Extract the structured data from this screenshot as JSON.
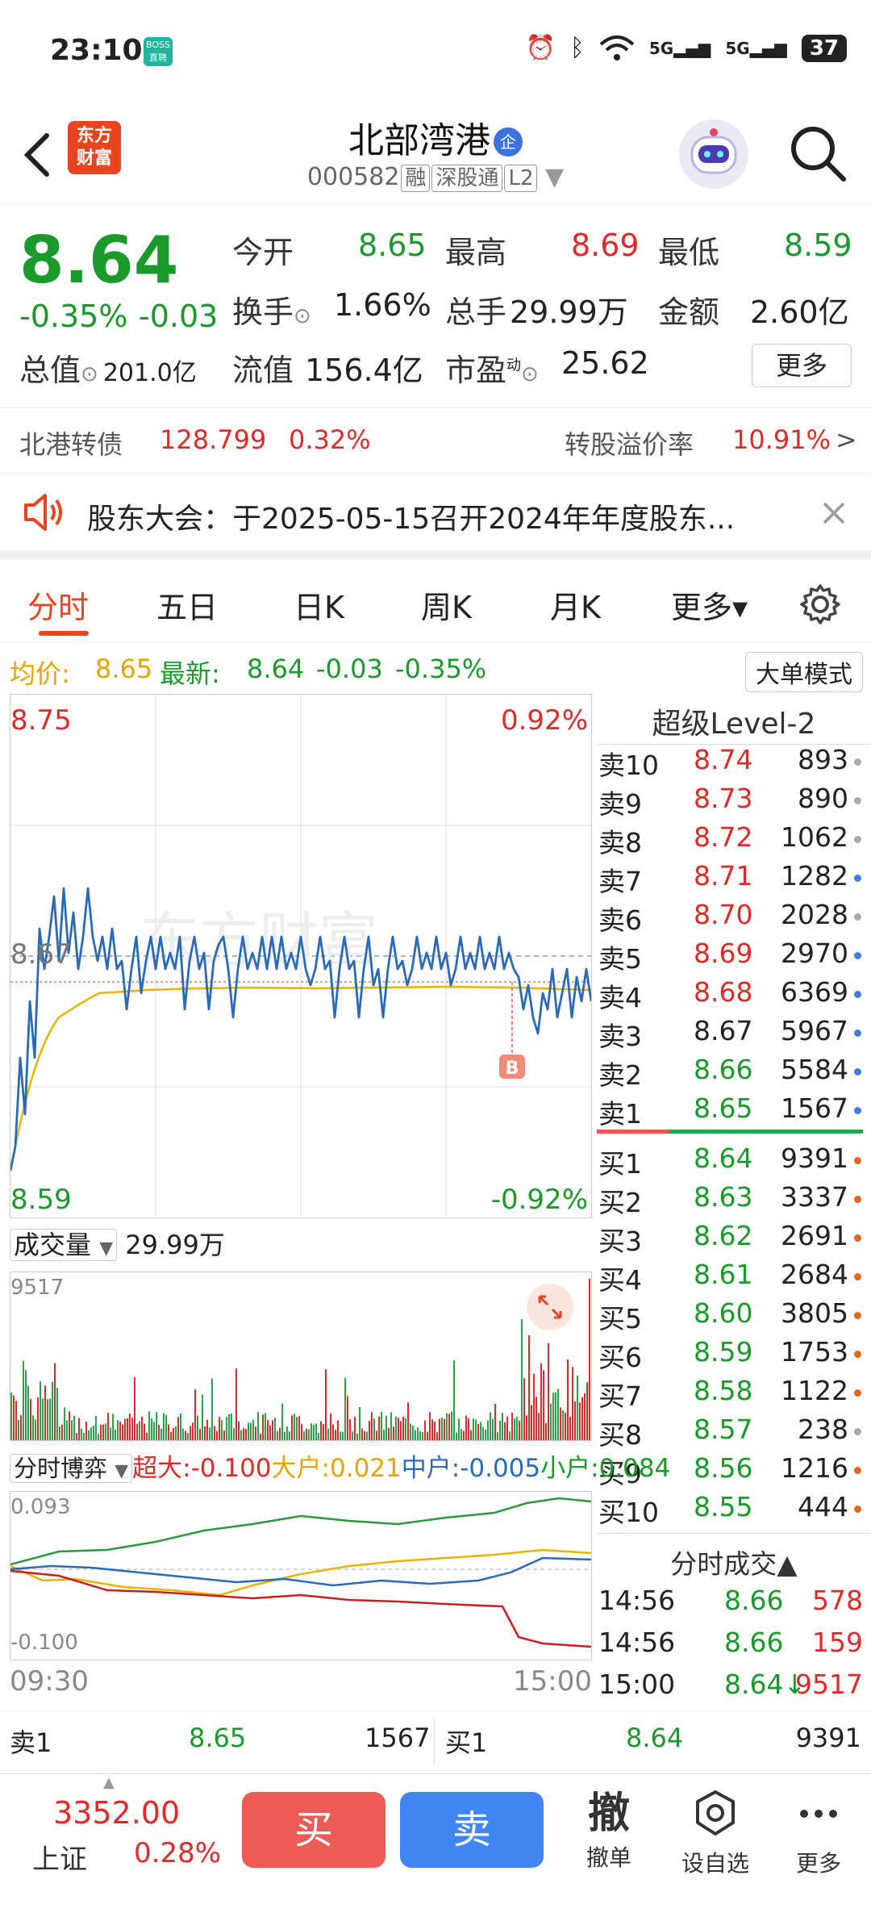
{
  "status": {
    "time": "23:10",
    "boss_line1": "BOSS",
    "boss_line2": "直聘",
    "battery": "37",
    "net1": "5G",
    "net2": "5G"
  },
  "header": {
    "logo_line1": "东方",
    "logo_line2": "财富",
    "name": "北部湾港",
    "badge": "企",
    "code": "000582",
    "tag1": "融",
    "tag2": "深股通",
    "tag3": "L2"
  },
  "quote": {
    "price": "8.64",
    "pct": "-0.35%",
    "change": "-0.03",
    "open_label": "今开",
    "open": "8.65",
    "high_label": "最高",
    "high": "8.69",
    "low_label": "最低",
    "low": "8.59",
    "turnover_label": "换手",
    "turnover": "1.66%",
    "volume_label": "总手",
    "volume": "29.99万",
    "amount_label": "金额",
    "amount": "2.60亿",
    "mcap_label": "总值",
    "mcap": "201.0亿",
    "float_label": "流值",
    "float": "156.4亿",
    "pe_label": "市盈",
    "pe_sup": "动",
    "pe": "25.62",
    "more": "更多"
  },
  "convertible": {
    "name": "北港转债",
    "price": "128.799",
    "pct": "0.32%",
    "premium_label": "转股溢价率",
    "premium": "10.91%",
    "arrow": ">"
  },
  "notice": {
    "text": "股东大会：于2025-05-15召开2024年年度股东..."
  },
  "tabs": [
    {
      "label": "分时"
    },
    {
      "label": "五日"
    },
    {
      "label": "日K"
    },
    {
      "label": "周K"
    },
    {
      "label": "月K"
    },
    {
      "label": "更多▾"
    }
  ],
  "intraday": {
    "avg_label": "均价:",
    "avg": "8.65",
    "latest_label": "最新:",
    "latest": "8.64",
    "chg": "-0.03",
    "pct": "-0.35%",
    "big_mode": "大单模式",
    "top_price": "8.75",
    "top_pct": "0.92%",
    "bottom_price": "8.59",
    "bottom_pct": "-0.92%",
    "mid_price": "8.67",
    "marker": "B",
    "watermark": "东方财富"
  },
  "level2": {
    "title": "超级Level-2",
    "asks": [
      {
        "k": "卖10",
        "p": "8.74",
        "v": "893",
        "c": "gray"
      },
      {
        "k": "卖9",
        "p": "8.73",
        "v": "890",
        "c": "gray"
      },
      {
        "k": "卖8",
        "p": "8.72",
        "v": "1062",
        "c": "gray"
      },
      {
        "k": "卖7",
        "p": "8.71",
        "v": "1282",
        "c": "blue"
      },
      {
        "k": "卖6",
        "p": "8.70",
        "v": "2028",
        "c": "gray"
      },
      {
        "k": "卖5",
        "p": "8.69",
        "v": "2970",
        "c": "blue"
      },
      {
        "k": "卖4",
        "p": "8.68",
        "v": "6369",
        "c": "blue"
      },
      {
        "k": "卖3",
        "p": "8.67",
        "v": "5967",
        "c": "blue"
      },
      {
        "k": "卖2",
        "p": "8.66",
        "v": "5584",
        "c": "blue"
      },
      {
        "k": "卖1",
        "p": "8.65",
        "v": "1567",
        "c": "blue"
      }
    ],
    "bids": [
      {
        "k": "买1",
        "p": "8.64",
        "v": "9391",
        "c": "orange"
      },
      {
        "k": "买2",
        "p": "8.63",
        "v": "3337",
        "c": "orange"
      },
      {
        "k": "买3",
        "p": "8.62",
        "v": "2691",
        "c": "orange"
      },
      {
        "k": "买4",
        "p": "8.61",
        "v": "2684",
        "c": "orange"
      },
      {
        "k": "买5",
        "p": "8.60",
        "v": "3805",
        "c": "orange"
      },
      {
        "k": "买6",
        "p": "8.59",
        "v": "1753",
        "c": "orange"
      },
      {
        "k": "买7",
        "p": "8.58",
        "v": "1122",
        "c": "orange"
      },
      {
        "k": "买8",
        "p": "8.57",
        "v": "238",
        "c": "gray"
      },
      {
        "k": "买9",
        "p": "8.56",
        "v": "1216",
        "c": "orange"
      },
      {
        "k": "买10",
        "p": "8.55",
        "v": "444",
        "c": "orange"
      }
    ],
    "ticks_title": "分时成交▲",
    "ticks": [
      {
        "t": "14:56",
        "p": "8.66",
        "v": "578"
      },
      {
        "t": "14:56",
        "p": "8.66",
        "v": "159"
      },
      {
        "t": "15:00",
        "p": "8.64↓",
        "v": "9517"
      }
    ]
  },
  "volume": {
    "label": "成交量",
    "total": "29.99万",
    "max": "9517"
  },
  "game": {
    "label": "分时博弈",
    "super": "超大:-0.100",
    "large": "大户:0.021",
    "mid": "中户:-0.005",
    "small": "小户:0.084",
    "top": "0.093",
    "bottom": "-0.100"
  },
  "time_axis": {
    "start": "09:30",
    "end": "15:00"
  },
  "bidbar": {
    "ask_label": "卖1",
    "ask_price": "8.65",
    "ask_vol": "1567",
    "bid_label": "买1",
    "bid_price": "8.64",
    "bid_vol": "9391"
  },
  "bottom": {
    "index_value": "3352.00",
    "index_name": "上证",
    "index_pct": "0.28%",
    "buy": "买",
    "sell": "卖",
    "cancel_glyph": "撤",
    "cancel": "撤单",
    "watch": "设自选",
    "more": "更多"
  }
}
